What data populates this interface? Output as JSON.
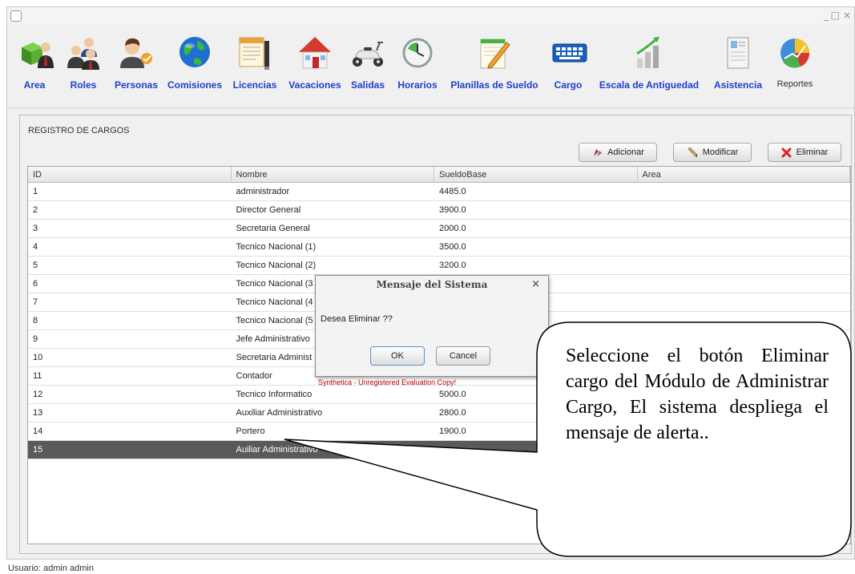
{
  "window": {
    "minimize": "_",
    "maximize": "□",
    "close": "×"
  },
  "toolbar": {
    "items": [
      {
        "label": "Area",
        "icon": "area-icon"
      },
      {
        "label": "Roles",
        "icon": "roles-icon"
      },
      {
        "label": "Personas",
        "icon": "personas-icon"
      },
      {
        "label": "Comisiones",
        "icon": "globe-icon"
      },
      {
        "label": "Licencias",
        "icon": "document-icon"
      },
      {
        "label": "Vacaciones",
        "icon": "house-icon"
      },
      {
        "label": "Salidas",
        "icon": "scooter-icon"
      },
      {
        "label": "Horarios",
        "icon": "clock-icon"
      },
      {
        "label": "Planillas de Sueldo",
        "icon": "notepad-pencil-icon"
      },
      {
        "label": "Cargo",
        "icon": "keyboard-icon"
      },
      {
        "label": "Escala de Antiguedad",
        "icon": "bar-chart-icon"
      },
      {
        "label": "Asistencia",
        "icon": "id-card-icon"
      },
      {
        "label": "Reportes",
        "icon": "pie-chart-icon"
      }
    ]
  },
  "panel": {
    "title": "REGISTRO DE CARGOS",
    "buttons": {
      "add": "Adicionar",
      "edit": "Modificar",
      "delete": "Eliminar"
    }
  },
  "table": {
    "columns": [
      "ID",
      "Nombre",
      "SueldoBase",
      "Area"
    ],
    "rows": [
      [
        "1",
        "administrador",
        "4485.0",
        ""
      ],
      [
        "2",
        "Director General",
        "3900.0",
        ""
      ],
      [
        "3",
        "Secretaria General",
        "2000.0",
        ""
      ],
      [
        "4",
        "Tecnico Nacional (1)",
        "3500.0",
        ""
      ],
      [
        "5",
        "Tecnico Nacional (2)",
        "3200.0",
        ""
      ],
      [
        "6",
        "Tecnico Nacional (3",
        "",
        ""
      ],
      [
        "7",
        "Tecnico Nacional (4",
        "",
        ""
      ],
      [
        "8",
        "Tecnico Nacional (5",
        "",
        ""
      ],
      [
        "9",
        "Jefe Administrativo",
        "",
        ""
      ],
      [
        "10",
        "Secretaria Administ",
        "",
        ""
      ],
      [
        "11",
        "Contador",
        "",
        ""
      ],
      [
        "12",
        "Tecnico Informatico",
        "5000.0",
        ""
      ],
      [
        "13",
        "Auxiliar Administrativo",
        "2800.0",
        ""
      ],
      [
        "14",
        "Portero",
        "1900.0",
        ""
      ],
      [
        "15",
        "Auiliar Administrativo",
        "",
        ""
      ]
    ],
    "selected_row": 15
  },
  "status": {
    "user": "Usuario: admin admin"
  },
  "dialog": {
    "title": "Mensaje del Sistema",
    "close": "×",
    "message": "Desea Eliminar ??",
    "ok": "OK",
    "cancel": "Cancel",
    "watermark": "Synthetica - Unregistered Evaluation Copy!"
  },
  "callout": {
    "text": "Seleccione el botón Eliminar cargo del Módulo de Administrar Cargo, El sistema despliega el mensaje de alerta.."
  },
  "colors": {
    "accent": "#1f40c8",
    "selected_row": "#5a5a5a",
    "watermark": "#c00000"
  }
}
